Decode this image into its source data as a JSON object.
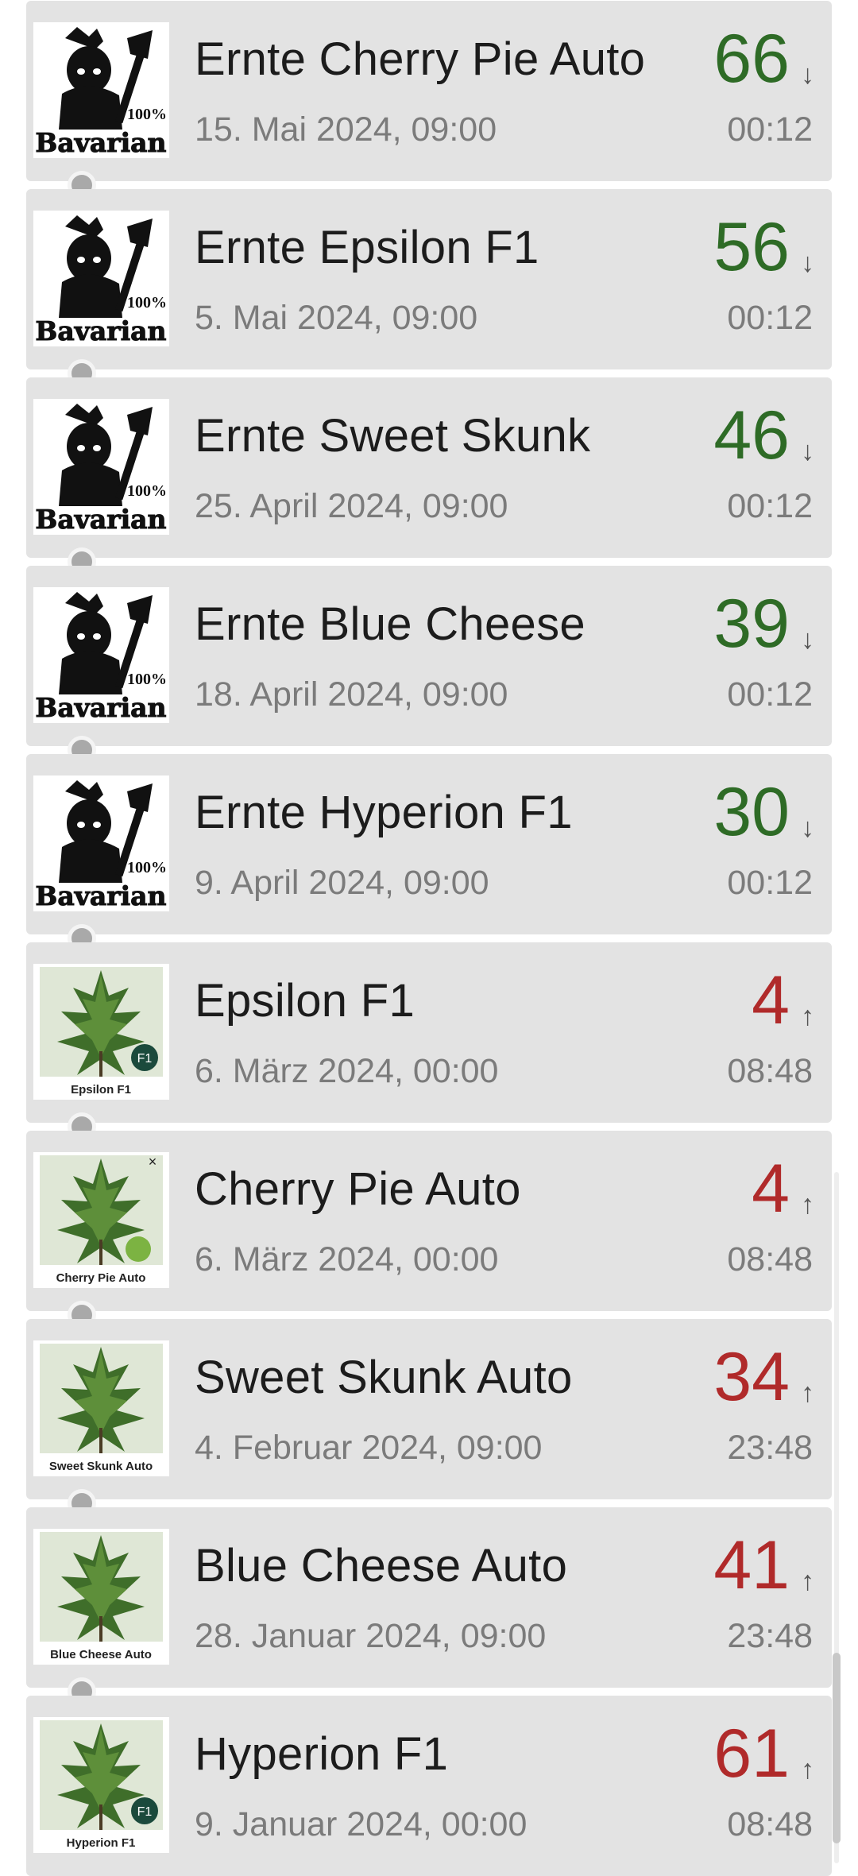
{
  "colors": {
    "down": "#2e6b26",
    "up": "#b02a2a"
  },
  "entries": [
    {
      "title": "Ernte Cherry Pie Auto",
      "date": "15. Mai 2024, 09:00",
      "count": "66",
      "arrow": "↓",
      "time": "00:12",
      "dir": "down",
      "thumb": "bavarian-logo",
      "thumb_text": "100%",
      "thumb_caption": "Bavarian"
    },
    {
      "title": "Ernte Epsilon F1",
      "date": "5. Mai 2024, 09:00",
      "count": "56",
      "arrow": "↓",
      "time": "00:12",
      "dir": "down",
      "thumb": "bavarian-logo",
      "thumb_text": "100%",
      "thumb_caption": "Bavarian"
    },
    {
      "title": "Ernte Sweet Skunk",
      "date": "25. April 2024, 09:00",
      "count": "46",
      "arrow": "↓",
      "time": "00:12",
      "dir": "down",
      "thumb": "bavarian-logo",
      "thumb_text": "100%",
      "thumb_caption": "Bavarian"
    },
    {
      "title": "Ernte Blue Cheese",
      "date": "18. April 2024, 09:00",
      "count": "39",
      "arrow": "↓",
      "time": "00:12",
      "dir": "down",
      "thumb": "bavarian-logo",
      "thumb_text": "100%",
      "thumb_caption": "Bavarian"
    },
    {
      "title": "Ernte Hyperion F1",
      "date": "9. April 2024, 09:00",
      "count": "30",
      "arrow": "↓",
      "time": "00:12",
      "dir": "down",
      "thumb": "bavarian-logo",
      "thumb_text": "100%",
      "thumb_caption": "Bavarian"
    },
    {
      "title": "Epsilon F1",
      "date": "6. März 2024, 00:00",
      "count": "4",
      "arrow": "↑",
      "time": "08:48",
      "dir": "up",
      "thumb": "plant-photo",
      "thumb_text": "Epsilon F1",
      "badge": "F1"
    },
    {
      "title": "Cherry Pie Auto",
      "date": "6. März 2024, 00:00",
      "count": "4",
      "arrow": "↑",
      "time": "08:48",
      "dir": "up",
      "thumb": "plant-photo",
      "thumb_text": "Cherry Pie Auto",
      "badge": "×"
    },
    {
      "title": "Sweet Skunk Auto",
      "date": "4. Februar 2024, 09:00",
      "count": "34",
      "arrow": "↑",
      "time": "23:48",
      "dir": "up",
      "thumb": "plant-photo",
      "thumb_text": "Sweet Skunk Auto"
    },
    {
      "title": "Blue Cheese Auto",
      "date": "28. Januar 2024, 09:00",
      "count": "41",
      "arrow": "↑",
      "time": "23:48",
      "dir": "up",
      "thumb": "plant-photo",
      "thumb_text": "Blue Cheese Auto"
    },
    {
      "title": "Hyperion F1",
      "date": "9. Januar 2024, 00:00",
      "count": "61",
      "arrow": "↑",
      "time": "08:48",
      "dir": "up",
      "thumb": "plant-photo",
      "thumb_text": "Hyperion F1",
      "badge": "F1"
    }
  ]
}
